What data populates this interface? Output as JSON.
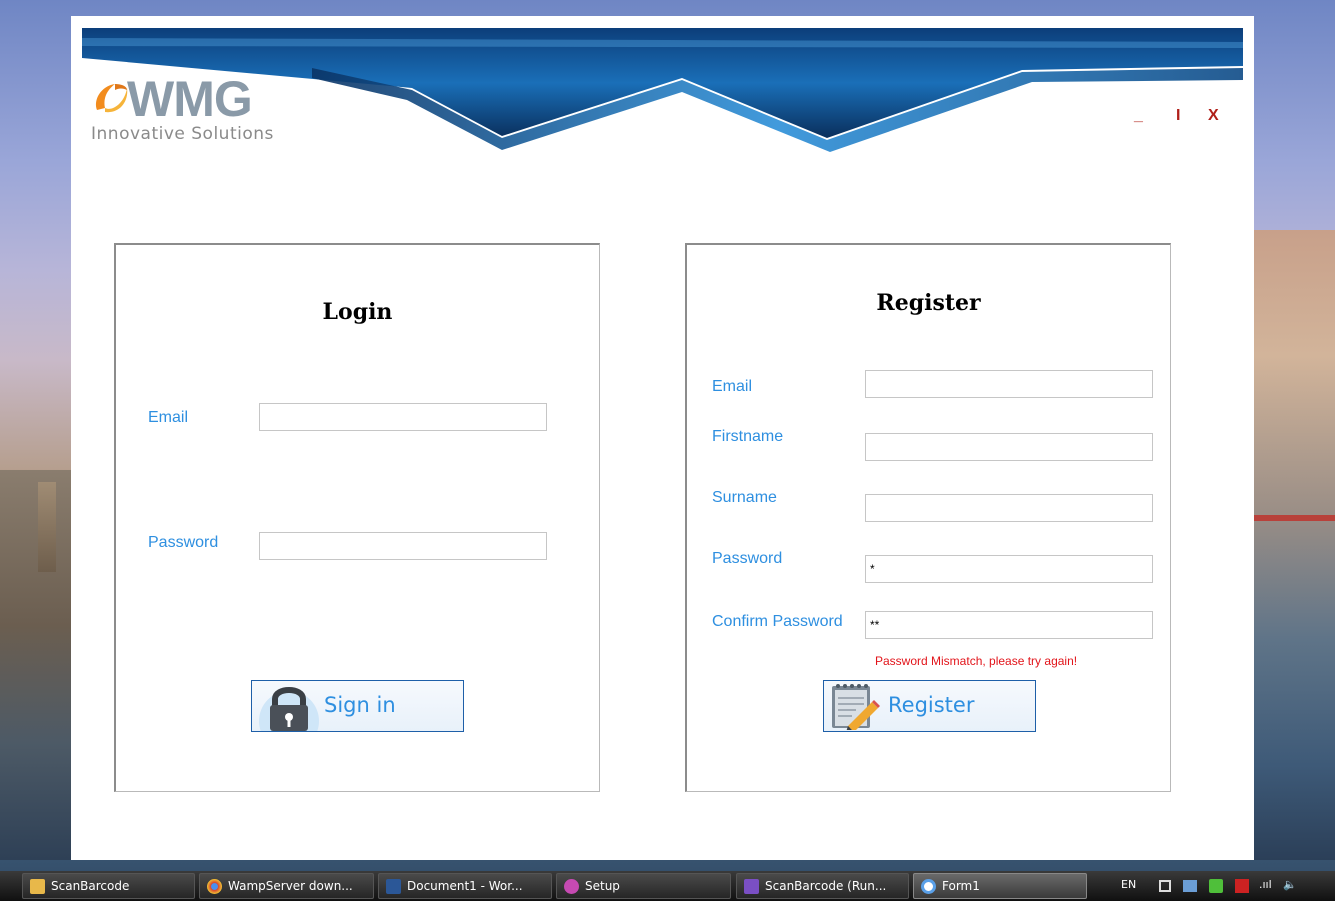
{
  "logo": {
    "wordmark": "WMG",
    "tagline": "Innovative Solutions"
  },
  "window_controls": {
    "minimize": "_",
    "maximize": "I",
    "close": "X"
  },
  "login": {
    "title": "Login",
    "email_label": "Email",
    "email_value": "",
    "password_label": "Password",
    "password_value": "",
    "sign_in_label": "Sign in"
  },
  "register": {
    "title": "Register",
    "email_label": "Email",
    "email_value": "",
    "firstname_label": "Firstname",
    "firstname_value": "",
    "surname_label": "Surname",
    "surname_value": "",
    "password_label": "Password",
    "password_value": "*",
    "confirm_label": "Confirm Password",
    "confirm_value": "**",
    "error_message": "Password Mismatch, please try again!",
    "register_label": "Register"
  },
  "taskbar": {
    "items": [
      {
        "label": "ScanBarcode",
        "icon": "folder-icon",
        "color": "#e8b84a"
      },
      {
        "label": "WampServer down...",
        "icon": "chrome-icon",
        "color": "#d9452f"
      },
      {
        "label": "Document1 - Wor...",
        "icon": "word-icon",
        "color": "#2b5797"
      },
      {
        "label": "Setup",
        "icon": "setup-icon",
        "color": "#c64ab2"
      },
      {
        "label": "ScanBarcode (Run...",
        "icon": "visual-studio-icon",
        "color": "#7a4fc4"
      },
      {
        "label": "Form1",
        "icon": "form-icon",
        "color": "#5aa0e8"
      }
    ],
    "tray": {
      "language": "EN",
      "signal": ".ııl"
    }
  },
  "colors": {
    "label_blue": "#2e8fe0",
    "error_red": "#e2141a",
    "control_red": "#b0201a",
    "button_border": "#1e5fa8"
  }
}
